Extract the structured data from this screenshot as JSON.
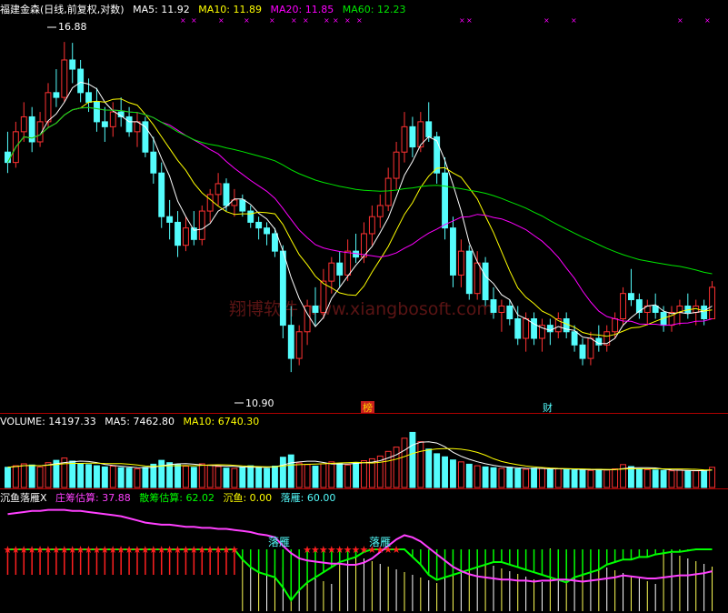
{
  "colors": {
    "background": "#000000",
    "up": "#ff3232",
    "down": "#54fcfc",
    "ma5": "#ffffff",
    "ma10": "#ffff00",
    "ma20": "#ff00ff",
    "ma60": "#00e600",
    "panel_border": "#b00000",
    "bar_white": "#ffffff",
    "bar_yellow": "#ffff55",
    "green_hist": "#00ff00",
    "red_hist": "#ff2020",
    "magenta_line": "#ff40ff",
    "badge_bg": "#c81e1e",
    "badge_text": "#ffd200",
    "watermark": "#5a1414"
  },
  "header_main": {
    "title": "福建金森(日线,前复权,对数)",
    "ma5": "MA5: 11.92",
    "ma10": "MA10: 11.89",
    "ma20": "MA20: 11.85",
    "ma60": "MA60: 12.23"
  },
  "header_volume": {
    "title": "VOLUME: 14197.33",
    "ma5": "MA5: 7462.80",
    "ma10": "MA10: 6740.30"
  },
  "header_indicator": {
    "title": "沉鱼落雁X",
    "zhuang": "庄筹估算: 37.88",
    "sanchou": "散筹估算: 62.02",
    "chenyu": "沉鱼: 0.00",
    "luoyan": "落雁: 60.00"
  },
  "annotations": {
    "high_price": "16.88",
    "low_price": "10.90",
    "badge_1": "榜",
    "badge_2": "财",
    "luoyan_1": "落雁",
    "luoyan_2": "落雁",
    "star_glyph": "★",
    "marker_glyph": "×"
  },
  "watermark": "翔博软件 www.xiangbosoft.com",
  "chart_data": {
    "type": "candlestick",
    "scale": "log",
    "price_range": [
      10.4,
      17.4
    ],
    "labeled_high": 16.88,
    "labeled_low": 10.9,
    "legend_placement": "top-left",
    "grid": false,
    "last_values": {
      "ma5": 11.92,
      "ma10": 11.89,
      "ma20": 11.85,
      "ma60": 12.23,
      "volume": 14197.33,
      "volume_ma5": 7462.8,
      "volume_ma10": 6740.3,
      "zhuang": 37.88,
      "sanchou": 62.02,
      "chenyu": 0.0,
      "luoyan": 60.0
    },
    "ohlc": [
      [
        14.6,
        15.0,
        14.2,
        14.4
      ],
      [
        14.4,
        15.2,
        14.3,
        15.0
      ],
      [
        15.0,
        15.6,
        14.8,
        15.3
      ],
      [
        15.3,
        15.5,
        14.6,
        14.8
      ],
      [
        14.8,
        15.4,
        14.7,
        15.2
      ],
      [
        15.2,
        16.0,
        15.1,
        15.8
      ],
      [
        15.8,
        16.3,
        15.5,
        15.7
      ],
      [
        15.7,
        16.9,
        15.6,
        16.5
      ],
      [
        16.5,
        16.88,
        16.0,
        16.3
      ],
      [
        16.3,
        16.5,
        15.6,
        15.8
      ],
      [
        15.8,
        16.1,
        15.4,
        15.6
      ],
      [
        15.6,
        15.9,
        15.0,
        15.2
      ],
      [
        15.2,
        15.5,
        14.8,
        15.1
      ],
      [
        15.1,
        15.6,
        14.9,
        15.4
      ],
      [
        15.4,
        15.7,
        15.1,
        15.3
      ],
      [
        15.3,
        15.5,
        14.9,
        15.0
      ],
      [
        15.0,
        15.4,
        14.7,
        15.2
      ],
      [
        15.2,
        15.3,
        14.5,
        14.6
      ],
      [
        14.6,
        14.9,
        14.0,
        14.2
      ],
      [
        14.2,
        14.4,
        13.2,
        13.4
      ],
      [
        13.4,
        13.7,
        13.0,
        13.3
      ],
      [
        13.3,
        13.5,
        12.7,
        12.9
      ],
      [
        12.9,
        13.4,
        12.8,
        13.2
      ],
      [
        13.2,
        13.5,
        12.9,
        13.0
      ],
      [
        13.0,
        13.6,
        12.9,
        13.5
      ],
      [
        13.5,
        13.9,
        13.3,
        13.8
      ],
      [
        13.8,
        14.2,
        13.6,
        14.0
      ],
      [
        14.0,
        14.1,
        13.5,
        13.6
      ],
      [
        13.6,
        13.9,
        13.4,
        13.7
      ],
      [
        13.7,
        13.8,
        13.4,
        13.5
      ],
      [
        13.5,
        13.6,
        13.2,
        13.3
      ],
      [
        13.3,
        13.4,
        13.0,
        13.2
      ],
      [
        13.2,
        13.3,
        12.9,
        13.1
      ],
      [
        13.1,
        13.2,
        12.7,
        12.8
      ],
      [
        12.8,
        12.9,
        11.4,
        11.6
      ],
      [
        11.6,
        11.9,
        10.9,
        11.1
      ],
      [
        11.1,
        11.6,
        11.0,
        11.5
      ],
      [
        11.5,
        12.0,
        11.3,
        11.9
      ],
      [
        11.9,
        12.2,
        11.6,
        11.8
      ],
      [
        11.8,
        12.5,
        11.7,
        12.3
      ],
      [
        12.3,
        12.7,
        12.1,
        12.6
      ],
      [
        12.6,
        12.8,
        12.2,
        12.4
      ],
      [
        12.4,
        13.0,
        12.3,
        12.8
      ],
      [
        12.8,
        13.1,
        12.6,
        12.7
      ],
      [
        12.7,
        13.3,
        12.6,
        13.1
      ],
      [
        13.1,
        13.6,
        12.9,
        13.4
      ],
      [
        13.4,
        13.8,
        13.2,
        13.6
      ],
      [
        13.6,
        14.3,
        13.5,
        14.1
      ],
      [
        14.1,
        14.8,
        13.9,
        14.6
      ],
      [
        14.6,
        15.4,
        14.4,
        15.1
      ],
      [
        15.1,
        15.3,
        14.5,
        14.7
      ],
      [
        14.7,
        15.4,
        14.6,
        15.2
      ],
      [
        15.2,
        15.6,
        14.8,
        14.9
      ],
      [
        14.9,
        15.0,
        14.0,
        14.2
      ],
      [
        14.2,
        14.5,
        13.0,
        13.2
      ],
      [
        13.2,
        13.4,
        12.2,
        12.4
      ],
      [
        12.4,
        13.0,
        12.2,
        12.8
      ],
      [
        12.8,
        12.9,
        12.0,
        12.1
      ],
      [
        12.1,
        12.8,
        12.0,
        12.6
      ],
      [
        12.6,
        12.7,
        11.9,
        12.0
      ],
      [
        12.0,
        12.2,
        11.7,
        11.8
      ],
      [
        11.8,
        12.0,
        11.5,
        11.9
      ],
      [
        11.9,
        12.0,
        11.6,
        11.7
      ],
      [
        11.7,
        11.9,
        11.3,
        11.4
      ],
      [
        11.4,
        11.8,
        11.2,
        11.7
      ],
      [
        11.7,
        11.8,
        11.3,
        11.4
      ],
      [
        11.4,
        11.7,
        11.2,
        11.6
      ],
      [
        11.6,
        11.7,
        11.3,
        11.5
      ],
      [
        11.5,
        11.8,
        11.4,
        11.7
      ],
      [
        11.7,
        11.8,
        11.4,
        11.5
      ],
      [
        11.5,
        11.6,
        11.2,
        11.3
      ],
      [
        11.3,
        11.4,
        11.0,
        11.1
      ],
      [
        11.1,
        11.5,
        11.0,
        11.4
      ],
      [
        11.4,
        11.6,
        11.2,
        11.3
      ],
      [
        11.3,
        11.6,
        11.2,
        11.5
      ],
      [
        11.5,
        11.8,
        11.4,
        11.7
      ],
      [
        11.7,
        12.2,
        11.6,
        12.1
      ],
      [
        12.1,
        12.5,
        11.9,
        12.0
      ],
      [
        12.0,
        12.1,
        11.7,
        11.8
      ],
      [
        11.8,
        12.0,
        11.6,
        11.9
      ],
      [
        11.9,
        12.1,
        11.7,
        11.8
      ],
      [
        11.8,
        11.9,
        11.5,
        11.6
      ],
      [
        11.6,
        11.9,
        11.5,
        11.8
      ],
      [
        11.8,
        12.0,
        11.6,
        11.9
      ],
      [
        11.9,
        12.1,
        11.7,
        11.8
      ],
      [
        11.8,
        12.0,
        11.6,
        11.9
      ],
      [
        11.9,
        12.0,
        11.6,
        11.7
      ],
      [
        11.7,
        12.3,
        11.7,
        12.2
      ]
    ],
    "volume": [
      5200,
      5600,
      6100,
      5800,
      5300,
      6400,
      7000,
      7600,
      6800,
      6200,
      5900,
      5600,
      5300,
      5500,
      5100,
      5000,
      4800,
      5200,
      6000,
      7000,
      6400,
      5900,
      5500,
      5200,
      6100,
      5800,
      5400,
      5000,
      4900,
      5300,
      5600,
      5200,
      4900,
      5500,
      7800,
      8400,
      6300,
      5900,
      5500,
      6100,
      6600,
      6200,
      5800,
      6400,
      6900,
      7400,
      8100,
      9300,
      10400,
      12700,
      14197,
      11800,
      9900,
      8700,
      7900,
      7100,
      6600,
      6000,
      5600,
      5300,
      5100,
      4900,
      5200,
      4800,
      4700,
      5000,
      4900,
      4600,
      4800,
      4700,
      4500,
      4600,
      4400,
      4700,
      4500,
      4800,
      5900,
      5400,
      4800,
      4600,
      4500,
      4400,
      4300,
      4500,
      4200,
      4300,
      4400,
      5200
    ],
    "zhuang_chip": [
      92,
      93,
      94,
      95,
      95,
      96,
      96,
      96,
      95,
      95,
      94,
      93,
      92,
      91,
      90,
      88,
      86,
      84,
      83,
      82,
      82,
      81,
      80,
      80,
      79,
      79,
      78,
      78,
      77,
      76,
      75,
      73,
      72,
      70,
      62,
      55,
      50,
      48,
      47,
      46,
      45,
      45,
      44,
      44,
      46,
      50,
      56,
      62,
      68,
      72,
      70,
      66,
      60,
      54,
      48,
      42,
      38,
      35,
      33,
      32,
      31,
      30,
      30,
      29,
      29,
      28,
      29,
      29,
      30,
      30,
      29,
      28,
      29,
      30,
      31,
      32,
      34,
      33,
      32,
      31,
      31,
      32,
      33,
      34,
      34,
      35,
      36,
      37.88
    ],
    "balance_line": [
      0,
      0,
      0,
      0,
      0,
      0,
      0,
      0,
      0,
      0,
      0,
      0,
      0,
      0,
      0,
      0,
      0,
      0,
      0,
      0,
      0,
      0,
      0,
      0,
      0,
      0,
      0,
      0,
      0,
      -8,
      -14,
      -18,
      -20,
      -22,
      -30,
      -40,
      -32,
      -26,
      -22,
      -18,
      -14,
      -10,
      -8,
      -6,
      -2,
      0,
      0,
      0,
      0,
      0,
      -6,
      -12,
      -20,
      -24,
      -22,
      -20,
      -18,
      -16,
      -14,
      -12,
      -10,
      -10,
      -12,
      -14,
      -16,
      -18,
      -20,
      -22,
      -24,
      -26,
      -22,
      -20,
      -18,
      -16,
      -12,
      -10,
      -8,
      -8,
      -6,
      -6,
      -4,
      -3,
      -2,
      -2,
      -1,
      0,
      0,
      0
    ]
  }
}
